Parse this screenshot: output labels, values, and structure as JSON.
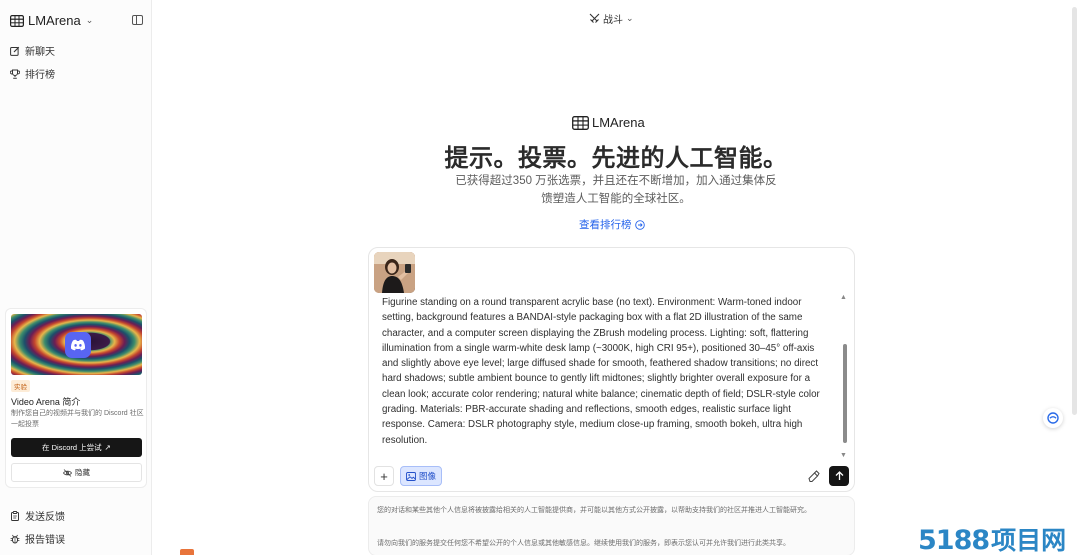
{
  "sidebar": {
    "brand": "LMArena",
    "nav": [
      {
        "label": "新聊天",
        "icon": "edit-icon"
      },
      {
        "label": "排行榜",
        "icon": "trophy-icon"
      }
    ],
    "promo": {
      "tag": "实验",
      "title": "Video Arena 简介",
      "description": "制作您自己的视频并与我们的 Discord 社区一起投票",
      "cta_label": "在 Discord 上尝试",
      "hide_label": "隐藏"
    },
    "footer": [
      {
        "label": "发送反馈",
        "icon": "clipboard-icon"
      },
      {
        "label": "报告错误",
        "icon": "bug-icon"
      }
    ]
  },
  "topbar": {
    "mode": "战斗"
  },
  "hero": {
    "logo_text": "LMArena",
    "title": "提示。投票。先进的人工智能。",
    "subtitle": "已获得超过350 万张选票，并且还在不断增加，加入通过集体反馈塑造人工智能的全球社区。",
    "link": "查看排行榜"
  },
  "composer": {
    "prompt": "Figurine standing on a round transparent acrylic base (no text). Environment: Warm-toned indoor setting, background features a BANDAI-style packaging box with a flat 2D illustration of the same character, and a computer screen displaying the ZBrush modeling process. Lighting: soft, flattering illumination from a single warm-white desk lamp (~3000K, high CRI 95+), positioned 30–45° off-axis and slightly above eye level; large diffused shade for smooth, feathered shadow transitions; no direct hard shadows; subtle ambient bounce to gently lift midtones; slightly brighter overall exposure for a clean look; accurate color rendering; natural white balance; cinematic depth of field; DSLR-style color grading. Materials: PBR-accurate shading and reflections, smooth edges, realistic surface light response. Camera: DSLR photography style, medium close-up framing, smooth bokeh, ultra high resolution.",
    "add_label": "+",
    "image_mode_label": "图像"
  },
  "notice": {
    "line1": "您的对话和某些其他个人信息将被披露给相关的人工智能提供商，并可能以其他方式公开披露，以帮助支持我们的社区并推进人工智能研究。",
    "line2": "请勿向我们的服务提交任何您不希望公开的个人信息或其他敏感信息。继续使用我们的服务，即表示您认可并允许我们进行此类共享。"
  },
  "watermark": {
    "number": "5188",
    "text": "项目网"
  },
  "colors": {
    "accent": "#2563eb",
    "primary_button": "#151515",
    "image_mode_bg": "#dce6ff",
    "discord": "#5865f2",
    "tag_bg": "#fdecd7"
  }
}
